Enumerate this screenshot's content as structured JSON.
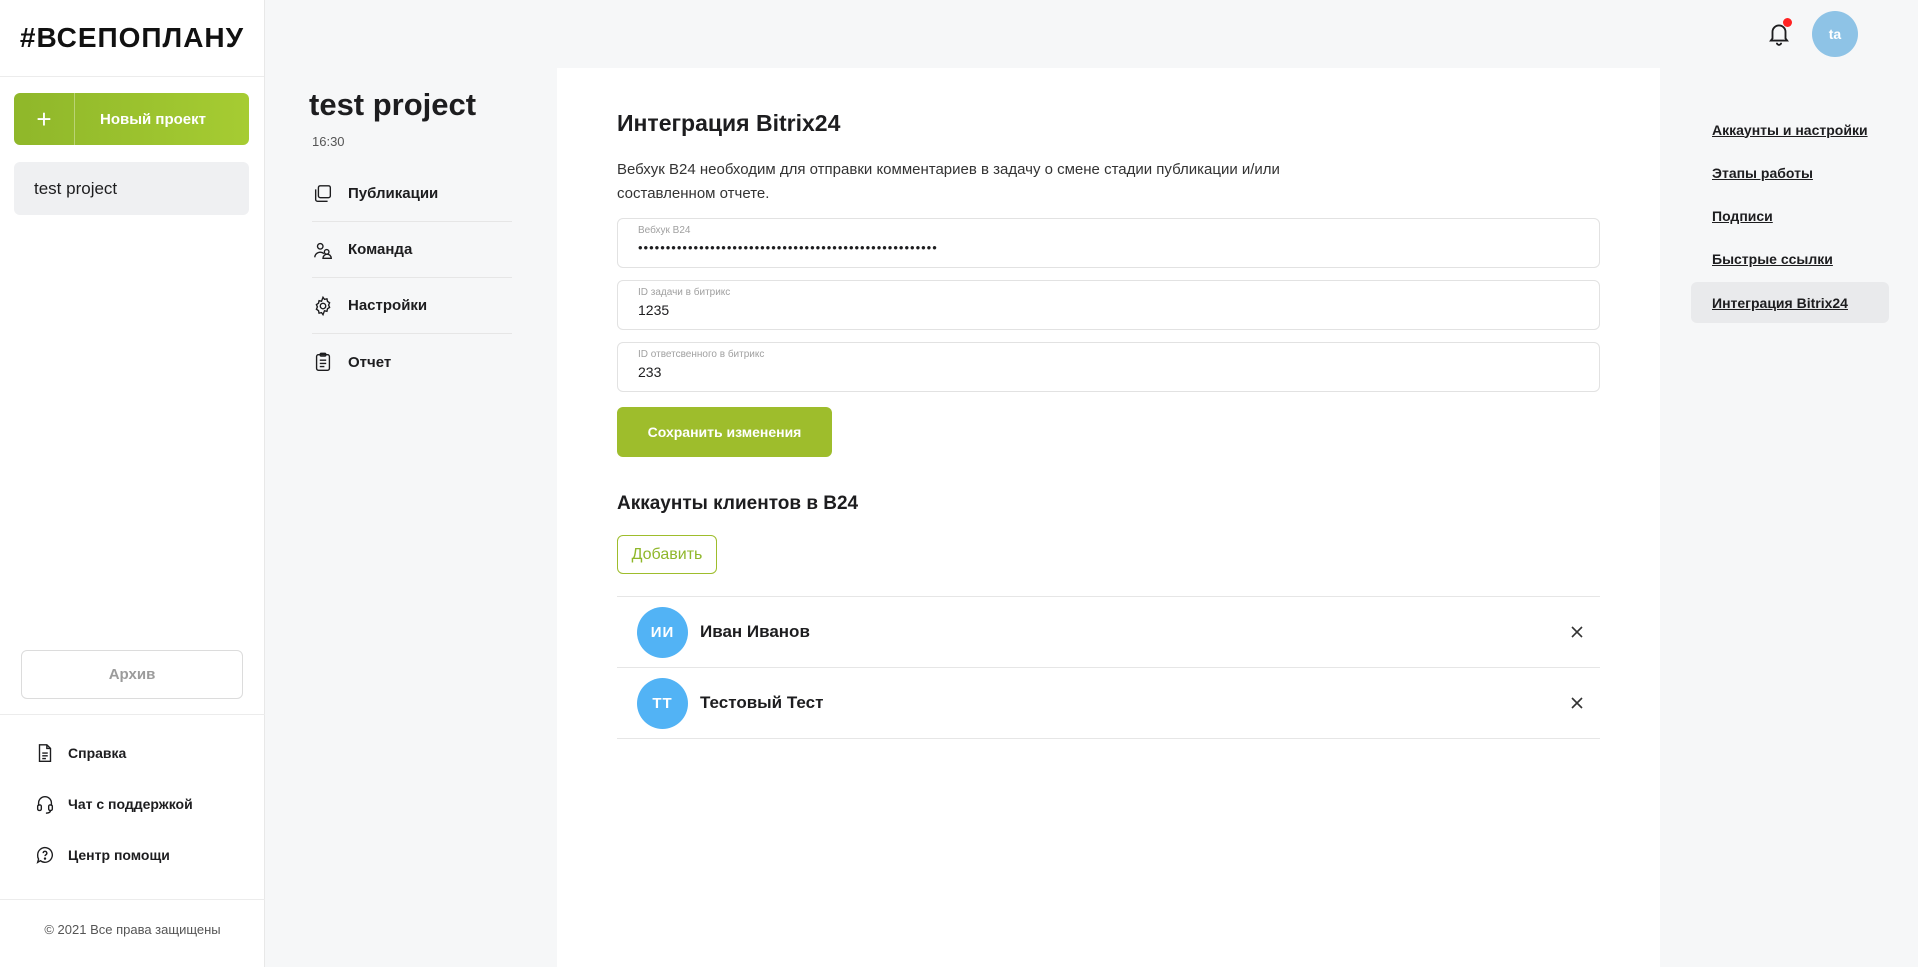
{
  "brand": {
    "logo_text": "#ВСЕПОПЛАНУ"
  },
  "sidebar": {
    "new_project_plus": "+",
    "new_project_label": "Новый проект",
    "projects": [
      {
        "label": "test project"
      }
    ],
    "archive_label": "Архив",
    "help_items": [
      {
        "label": "Справка",
        "icon": "document-icon"
      },
      {
        "label": "Чат с поддержкой",
        "icon": "headset-icon"
      },
      {
        "label": "Центр помощи",
        "icon": "help-chat-icon"
      }
    ],
    "copyright": "© 2021 Все права защищены"
  },
  "project": {
    "title": "test project",
    "time": "16:30",
    "nav": [
      {
        "label": "Публикации",
        "icon": "publications-icon"
      },
      {
        "label": "Команда",
        "icon": "team-icon"
      },
      {
        "label": "Настройки",
        "icon": "gear-icon"
      },
      {
        "label": "Отчет",
        "icon": "clipboard-icon"
      }
    ]
  },
  "header": {
    "user_initials": "ta",
    "notification_dot_color": "#ff2222"
  },
  "main": {
    "title": "Интеграция Bitrix24",
    "description": "Вебхук B24 необходим для отправки комментариев в задачу о смене стадии публикации и/или составленном отчете.",
    "fields": [
      {
        "label": "Вебхук B24",
        "value": "••••••••••••••••••••••••••••••••••••••••••••••••••••••"
      },
      {
        "label": "ID задачи в битрикс",
        "value": "1235"
      },
      {
        "label": "ID ответсвенного в битрикс",
        "value": "233"
      }
    ],
    "save_label": "Сохранить изменения",
    "clients_title": "Аккаунты клиентов в B24",
    "add_label": "Добавить",
    "clients": [
      {
        "initials": "ИИ",
        "name": "Иван Иванов"
      },
      {
        "initials": "ТТ",
        "name": "Тестовый Тест"
      }
    ]
  },
  "right_nav": [
    {
      "label": "Аккаунты и настройки",
      "active": false
    },
    {
      "label": "Этапы работы",
      "active": false
    },
    {
      "label": "Подписи",
      "active": false
    },
    {
      "label": "Быстрые ссылки",
      "active": false
    },
    {
      "label": "Интеграция Bitrix24",
      "active": true
    }
  ],
  "colors": {
    "accent": "#9ebd2c",
    "client_avatar": "#52b3f5",
    "user_avatar": "#8ec3e6"
  }
}
